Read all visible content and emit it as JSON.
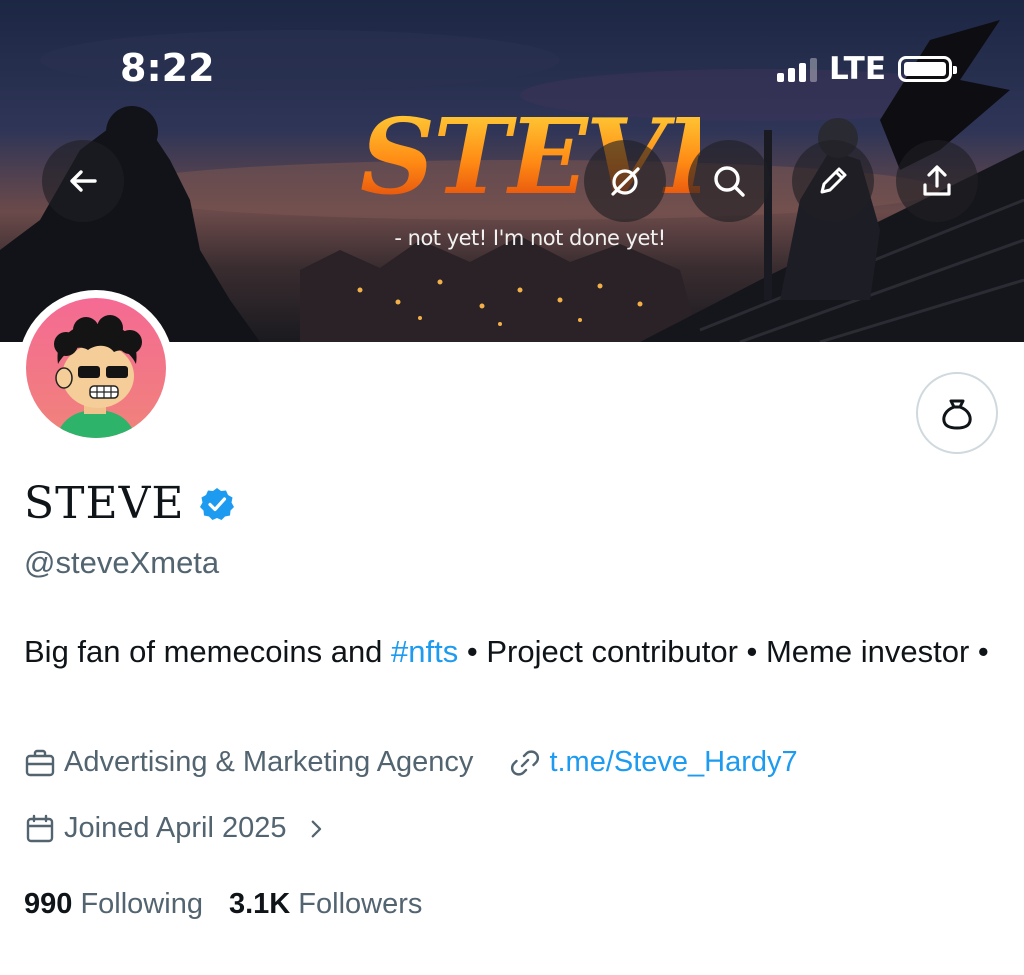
{
  "status_bar": {
    "time": "8:22",
    "network": "LTE"
  },
  "banner": {
    "title": "STEVE",
    "subtitle": "- not yet! I'm not done yet!"
  },
  "header_actions": {
    "back": "back-arrow-icon",
    "grok": "grok-icon",
    "search": "search-icon",
    "edit": "pencil-icon",
    "share": "share-icon"
  },
  "profile": {
    "display_name": "STEVE",
    "verified": true,
    "handle": "@steveXmeta",
    "bio_before": "Big fan of memecoins and ",
    "bio_hashtag": "#nfts",
    "bio_after": " • Project contributor • Meme investor •",
    "category": "Advertising & Marketing Agency",
    "website": "t.me/Steve_Hardy7",
    "joined": "Joined April 2025",
    "following_count": "990",
    "following_label": "Following",
    "followers_count": "3.1K",
    "followers_label": "Followers"
  },
  "colors": {
    "accent": "#1d9bf0",
    "secondary_text": "#536471",
    "primary_text": "#0f1419",
    "verified_badge": "#1d9bf0"
  }
}
